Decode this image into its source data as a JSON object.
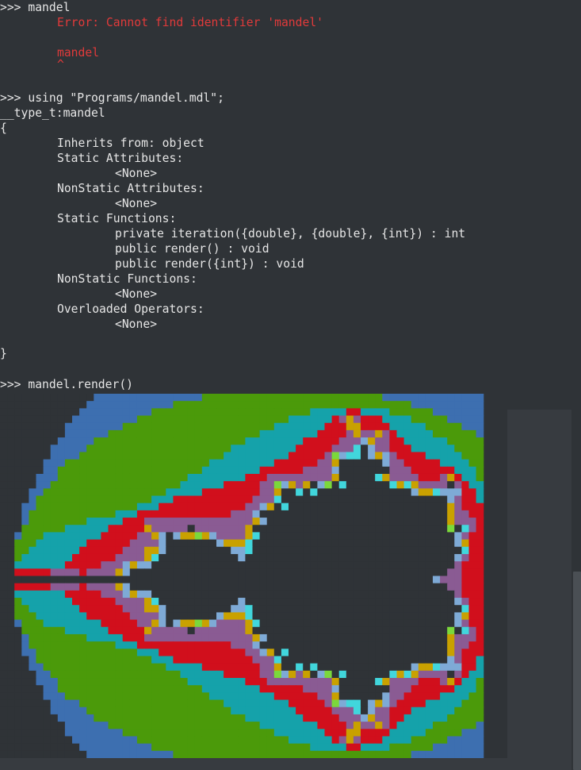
{
  "console": {
    "prompt": ">>> ",
    "lines": {
      "l1": ">>> mandel",
      "l2": "Error: Cannot find identifier 'mandel'",
      "l3": "mandel",
      "l4": "^",
      "l5": ">>> using \"Programs/mandel.mdl\";",
      "l6": "__type_t:mandel",
      "l7": "{",
      "l8": "Inherits from: object",
      "l9": "Static Attributes:",
      "l10": "<None>",
      "l11": "NonStatic Attributes:",
      "l12": "<None>",
      "l13": "Static Functions:",
      "l14": "private iteration({double}, {double}, {int}) : int",
      "l15": "public render() : void",
      "l16": "public render({int}) : void",
      "l17": "NonStatic Functions:",
      "l18": "<None>",
      "l19": "Overloaded Operators:",
      "l20": "<None>",
      "l21": "}",
      "l22": ">>> mandel.render()"
    }
  },
  "render_output": {
    "description_name": "mandelbrot-render",
    "palette": {
      "bg": "#2f3337",
      "blue": "#3d6fb0",
      "green": "#4b9a0a",
      "teal": "#15a2aa",
      "red": "#d10f1c",
      "purple": "#8a5b93",
      "gold": "#c9a100",
      "lightblue": "#7eaad6",
      "cyan": "#41d6dc",
      "lime": "#7bd83b",
      "white": "#e2e2e2",
      "yellow": "#f2e45e",
      "gray": "#5a5e63",
      "lightgray": "#b8b8b8"
    }
  },
  "colors": {
    "background": "#2f3337",
    "text": "#e6e6e6",
    "error": "#e23a3a"
  }
}
